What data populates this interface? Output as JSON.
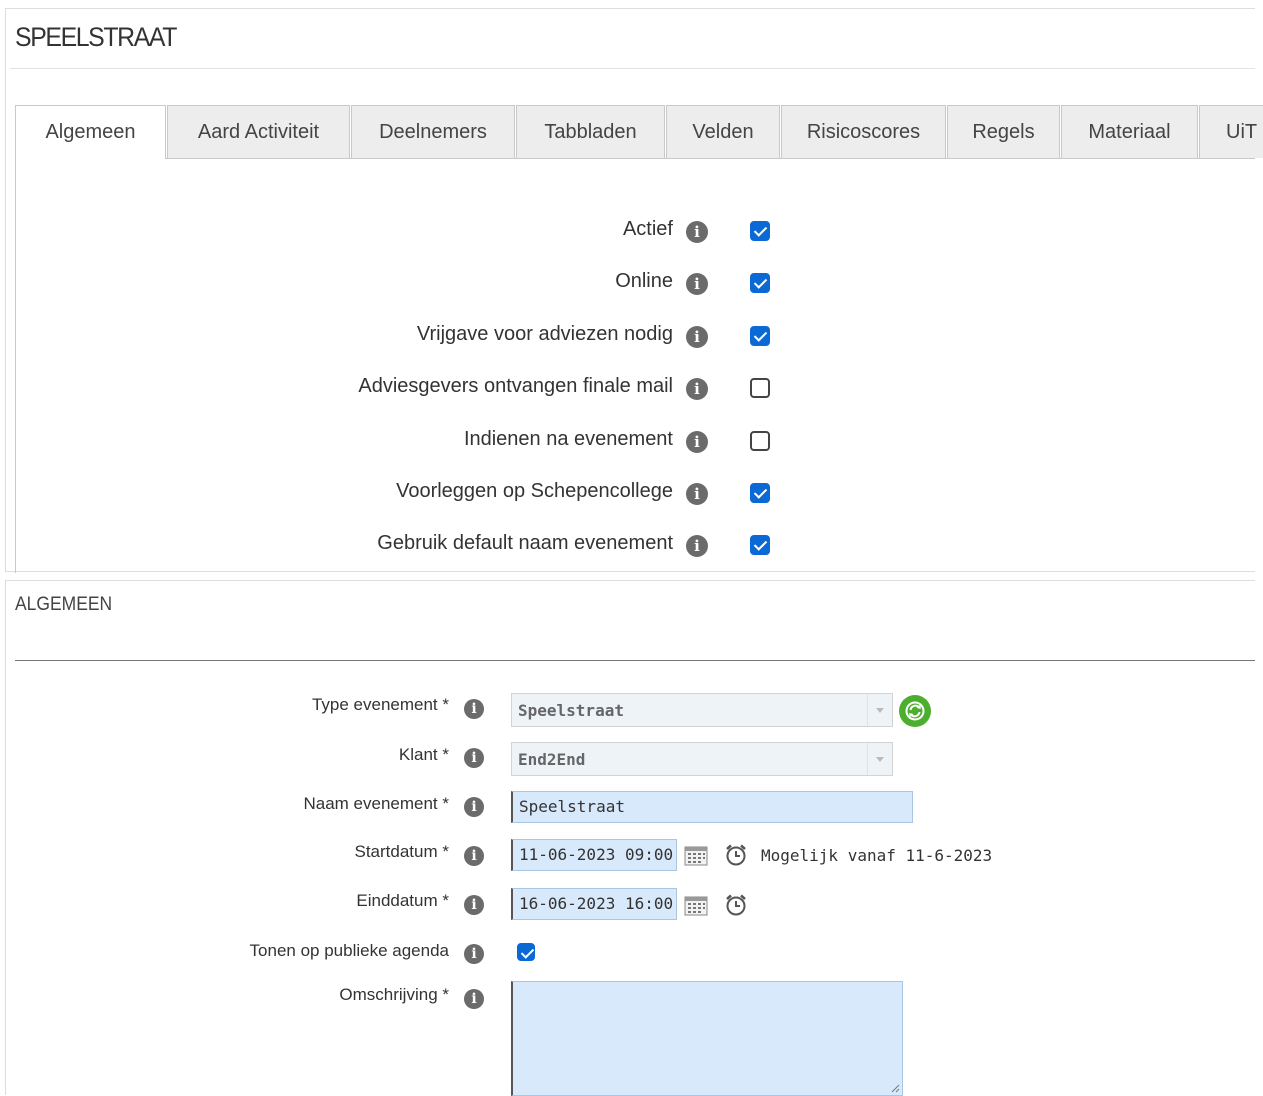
{
  "page": {
    "title": "SPEELSTRAAT"
  },
  "tabs": [
    {
      "label": "Algemeen",
      "active": true
    },
    {
      "label": "Aard Activiteit"
    },
    {
      "label": "Deelnemers"
    },
    {
      "label": "Tabbladen"
    },
    {
      "label": "Velden"
    },
    {
      "label": "Risicoscores"
    },
    {
      "label": "Regels"
    },
    {
      "label": "Materiaal"
    },
    {
      "label": "UiT"
    }
  ],
  "options": [
    {
      "label": "Actief",
      "checked": true
    },
    {
      "label": "Online",
      "checked": true
    },
    {
      "label": "Vrijgave voor adviezen nodig",
      "checked": true
    },
    {
      "label": "Adviesgevers ontvangen finale mail",
      "checked": false
    },
    {
      "label": "Indienen na evenement",
      "checked": false
    },
    {
      "label": "Voorleggen op Schepencollege",
      "checked": true
    },
    {
      "label": "Gebruik default naam evenement",
      "checked": true
    }
  ],
  "section": {
    "title": "ALGEMEEN",
    "fields": {
      "type_evenement": {
        "label": "Type evenement *",
        "value": "Speelstraat"
      },
      "klant": {
        "label": "Klant *",
        "value": "End2End"
      },
      "naam_evenement": {
        "label": "Naam evenement *",
        "value": "Speelstraat"
      },
      "startdatum": {
        "label": "Startdatum *",
        "value": "11-06-2023 09:00",
        "hint": "Mogelijk vanaf 11-6-2023"
      },
      "einddatum": {
        "label": "Einddatum *",
        "value": "16-06-2023 16:00"
      },
      "tonen_publieke_agenda": {
        "label": "Tonen op publieke agenda",
        "checked": true
      },
      "omschrijving": {
        "label": "Omschrijving *",
        "value": ""
      }
    }
  },
  "icons": {
    "info": "i"
  },
  "colors": {
    "checkbox": "#0b69d6",
    "input_bg": "#d8e9fb",
    "refresh": "#4cae2e"
  }
}
